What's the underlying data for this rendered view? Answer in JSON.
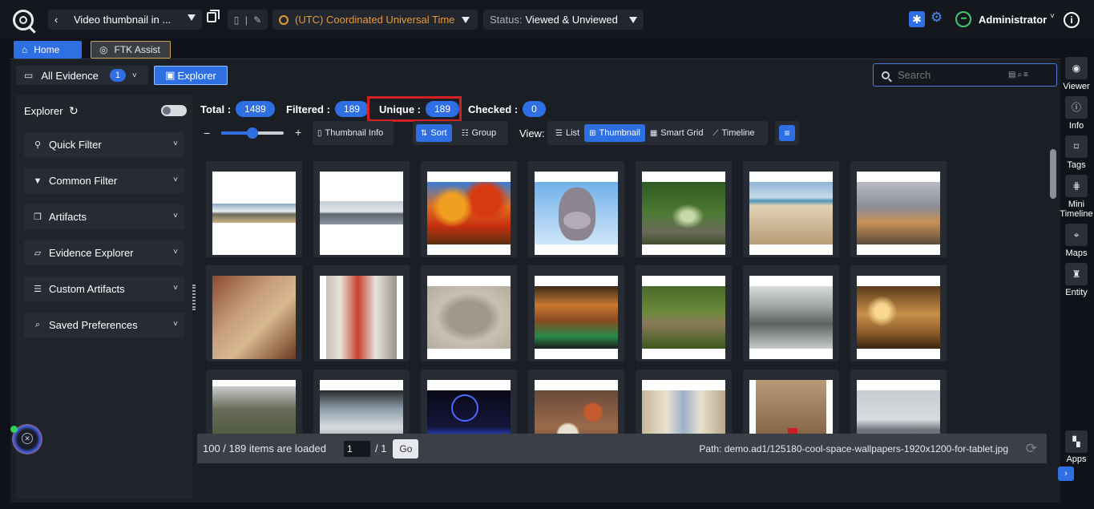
{
  "topbar": {
    "case_name": "Video thumbnail in ...",
    "timezone": "(UTC) Coordinated Universal Time",
    "status_label": "Status:",
    "status_value": "Viewed & Unviewed",
    "user_name": "Administrator"
  },
  "tabs": [
    {
      "label": "Home"
    },
    {
      "label": "FTK Assist"
    }
  ],
  "toolbar": {
    "evidence_label": "All Evidence",
    "evidence_count": "1",
    "explorer_label": "Explorer",
    "search_placeholder": "Search"
  },
  "sidebar": {
    "title": "Explorer",
    "items": [
      {
        "label": "Quick Filter",
        "icon": "quick-filter-icon"
      },
      {
        "label": "Common Filter",
        "icon": "filter-icon"
      },
      {
        "label": "Artifacts",
        "icon": "artifacts-icon"
      },
      {
        "label": "Evidence Explorer",
        "icon": "folder-icon"
      },
      {
        "label": "Custom Artifacts",
        "icon": "database-icon"
      },
      {
        "label": "Saved Preferences",
        "icon": "search-icon"
      }
    ]
  },
  "counts": {
    "total_label": "Total :",
    "total_value": "1489",
    "filtered_label": "Filtered :",
    "filtered_value": "189",
    "unique_label": "Unique :",
    "unique_value": "189",
    "checked_label": "Checked :",
    "checked_value": "0"
  },
  "controls": {
    "zoom_minus": "−",
    "zoom_plus": "+",
    "zoom_level": 0.5,
    "thumbnail_info": "Thumbnail Info",
    "sort": "Sort",
    "group": "Group",
    "view_label": "View:",
    "views": [
      "List",
      "Thumbnail",
      "Smart Grid",
      "Timeline"
    ],
    "active_view": "Thumbnail"
  },
  "footer": {
    "loaded_text": "100 / 189 items are loaded",
    "page_value": "1",
    "page_total": "/ 1",
    "go_label": "Go",
    "path_text": "Path: demo.ad1/125180-cool-space-wallpapers-1920x1200-for-tablet.jpg"
  },
  "right_rail": [
    {
      "label": "Viewer",
      "icon": "eye-icon"
    },
    {
      "label": "Info",
      "icon": "info-icon"
    },
    {
      "label": "Tags",
      "icon": "bookmark-icon"
    },
    {
      "label": "Mini Timeline",
      "icon": "mini-timeline-icon"
    },
    {
      "label": "Maps",
      "icon": "map-pin-icon"
    },
    {
      "label": "Entity",
      "icon": "entity-icon"
    },
    {
      "label": "Apps",
      "icon": "apps-icon"
    }
  ],
  "thumbnails": [
    "beach-panorama",
    "harbor-panorama",
    "autumn-trees",
    "cartoon-hippo",
    "forest-path",
    "sandy-beach",
    "city-skyline",
    "stone-wall-person",
    "painted-doorway",
    "stone-carving",
    "market-interior",
    "garden-statues",
    "snowy-river",
    "ornate-lobby",
    "mountain-waterfall",
    "harbor-boats",
    "ferris-wheel-night",
    "food-table",
    "city-street",
    "royal-guard",
    "waterfront-city"
  ],
  "colors": {
    "accent": "#2f6fe4",
    "highlight_border": "#d42020",
    "timezone": "#e69a3c",
    "online": "#3ec86c"
  }
}
